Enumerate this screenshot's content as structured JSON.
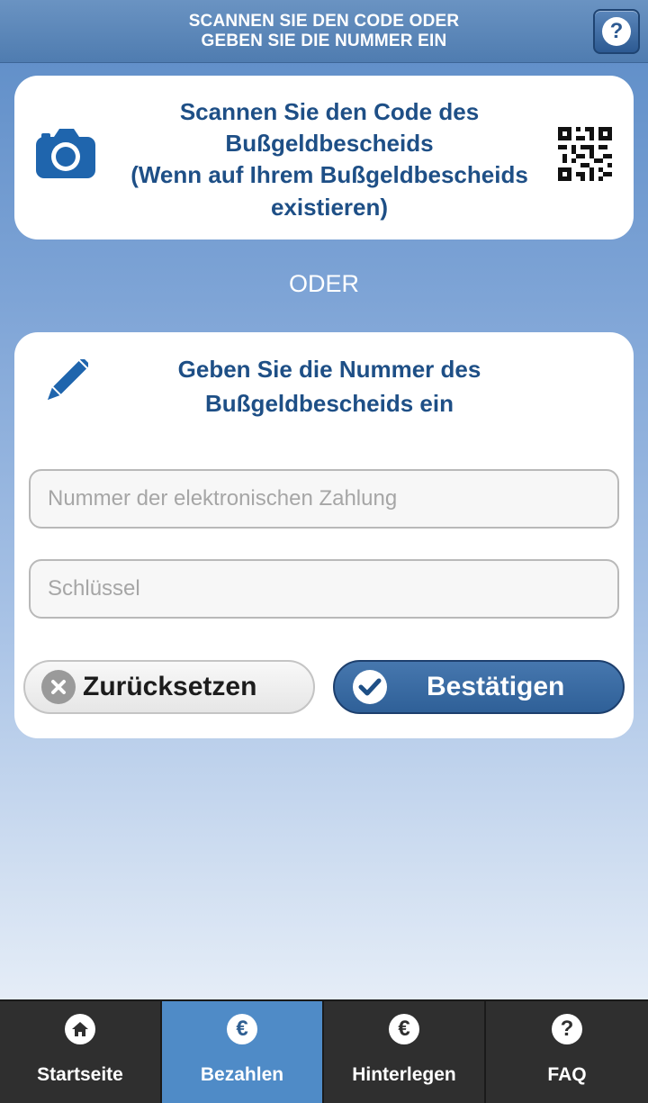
{
  "header": {
    "title": "SCANNEN SIE DEN CODE ODER\nGEBEN SIE DIE NUMMER EIN",
    "help_label": "?"
  },
  "scan_card": {
    "line1": "Scannen Sie den Code des",
    "line2": "Bußgeldbescheids",
    "line3": "(Wenn auf Ihrem Bußgeldbescheids existieren)"
  },
  "separator": "ODER",
  "entry_card": {
    "title": "Geben Sie die Nummer des Bußgeldbescheids ein",
    "number_input": {
      "placeholder": "Nummer der elektronischen Zahlung",
      "value": ""
    },
    "key_input": {
      "placeholder": "Schlüssel",
      "value": ""
    },
    "reset_label": "Zurücksetzen",
    "confirm_label": "Bestätigen"
  },
  "bottom_nav": {
    "items": [
      {
        "label": "Startseite",
        "icon": "home-icon"
      },
      {
        "label": "Bezahlen",
        "icon": "euro-icon",
        "active": true
      },
      {
        "label": "Hinterlegen",
        "icon": "euro-icon"
      },
      {
        "label": "FAQ",
        "icon": "question-icon"
      }
    ]
  },
  "colors": {
    "brand_blue": "#1e4f86",
    "active_tab": "#4f8bc7",
    "nav_bg": "#2f2f2f"
  }
}
